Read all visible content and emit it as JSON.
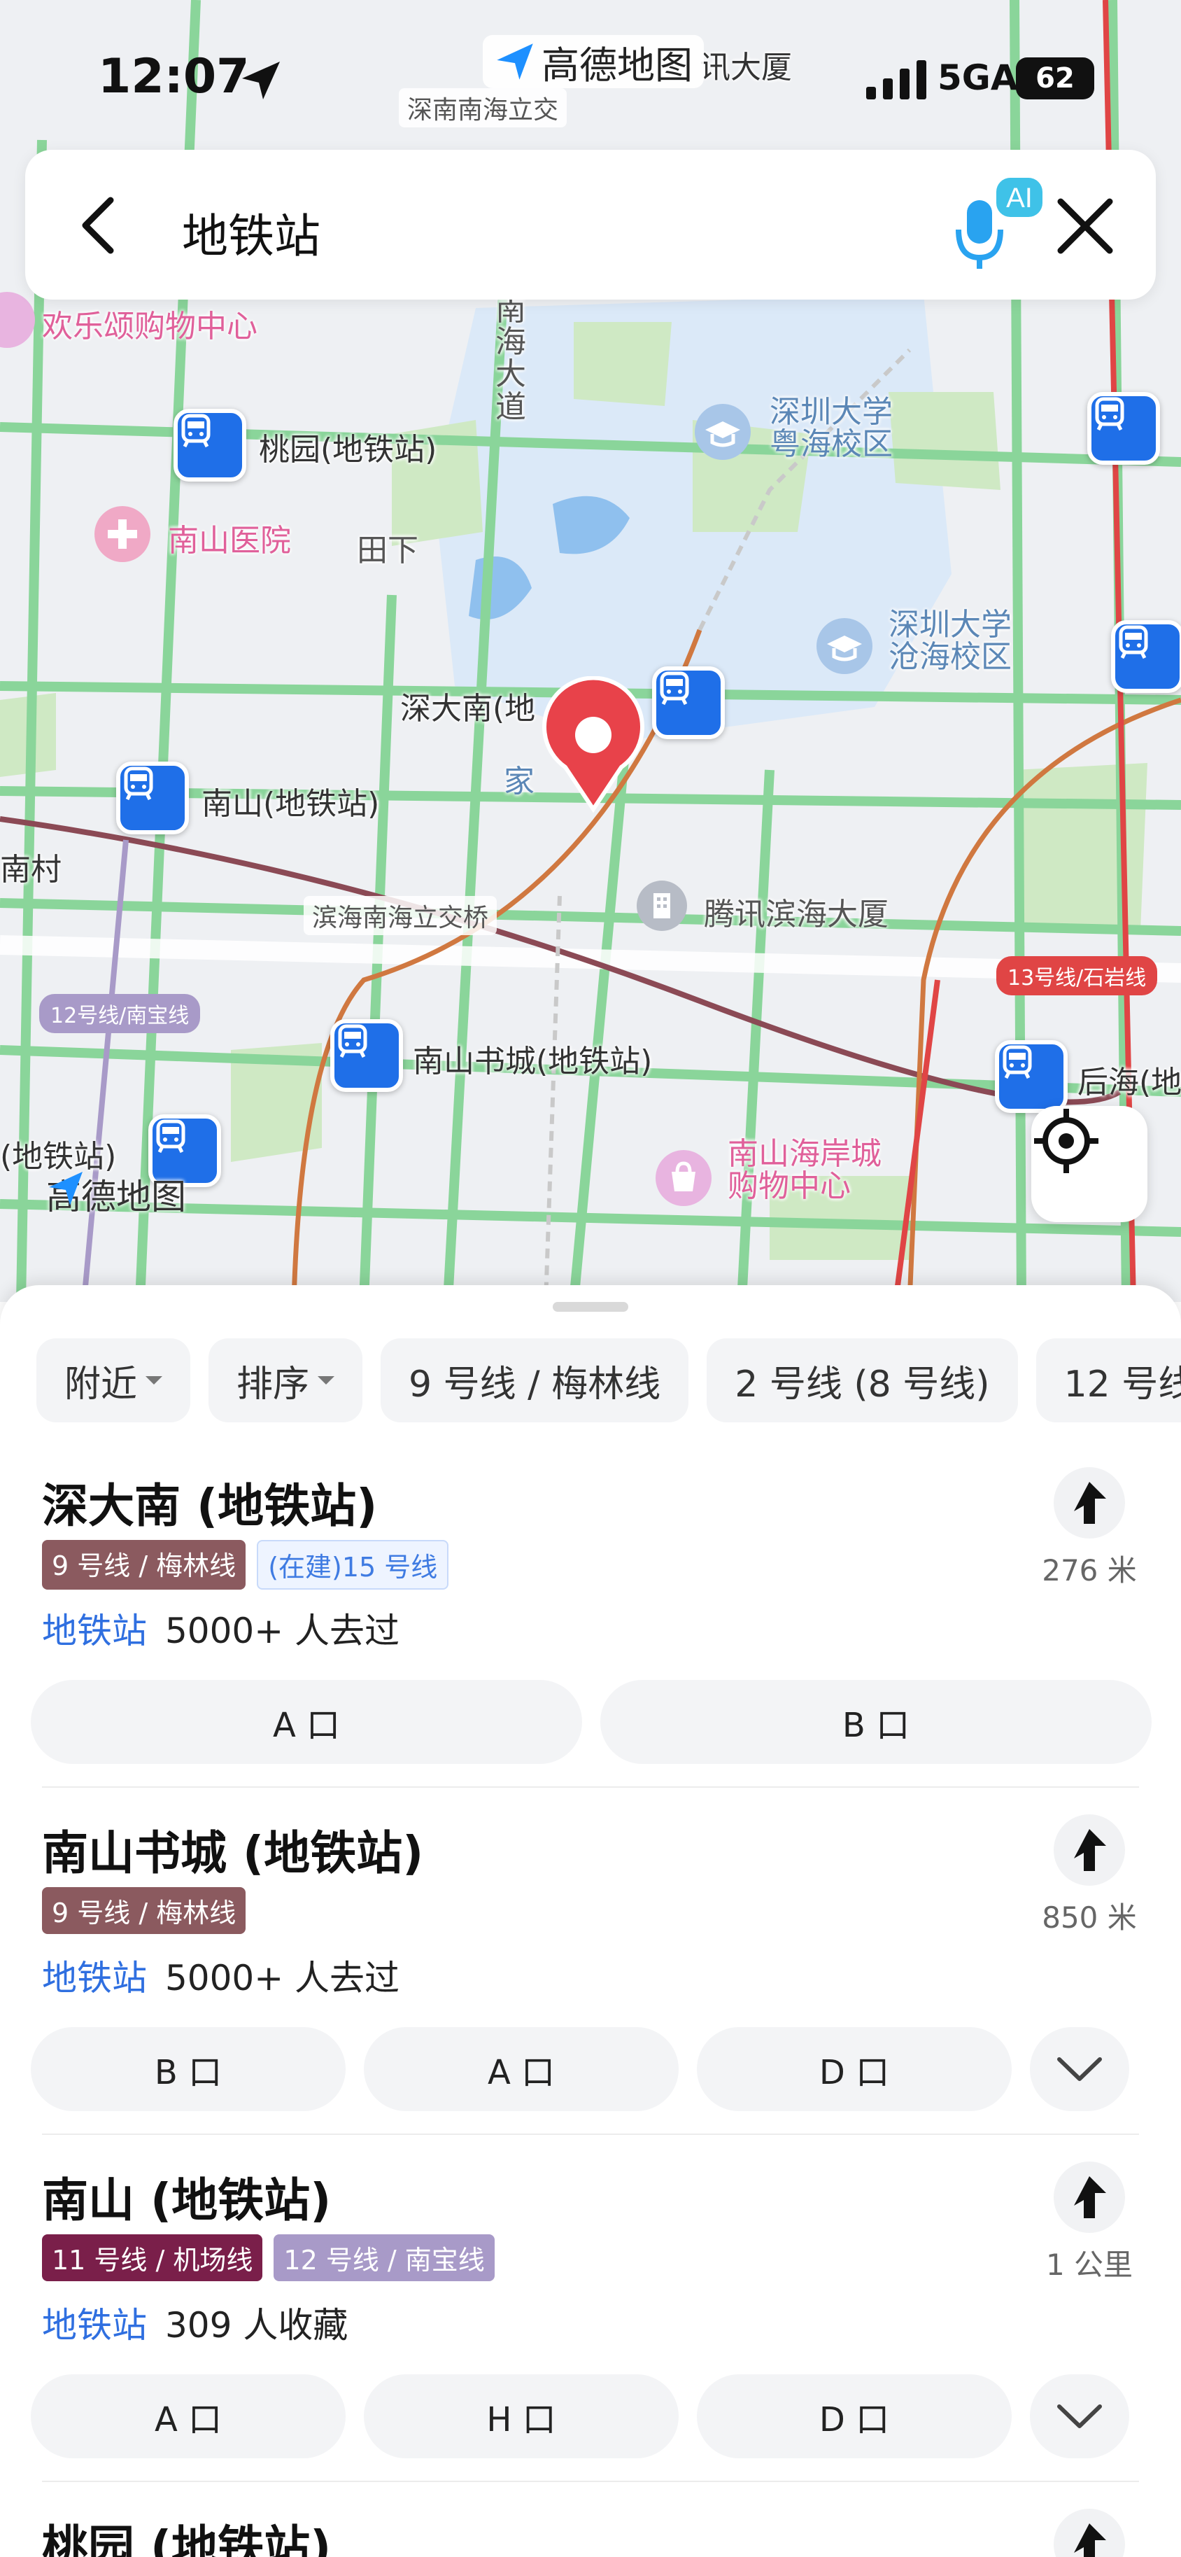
{
  "status": {
    "time": "12:07",
    "network": "5GA",
    "battery": "62"
  },
  "map": {
    "brand_top": "高德地图",
    "brand_bottom": "高德地图",
    "labels": {
      "xunxun": "讯大厦",
      "shennan_nanhai": "深南南海立交",
      "shen_partial": "深大",
      "huanle": "欢乐颂购物中心",
      "nanhai_dadao": "南海大道",
      "taoyuan": "桃园(地铁站)",
      "szu_yuehai": "深圳大学\n粤海校区",
      "nanshan_hospital": "南山医院",
      "tianxia": "田下",
      "szu_canghai": "深圳大学\n沧海校区",
      "shendanan_partial": "深大南(地",
      "jia": "家",
      "nanshan": "南山(地铁站)",
      "nancun": "南村",
      "binhai_lijiao": "滨海南海立交桥",
      "tencent": "腾讯滨海大厦",
      "line13": "13号线/石岩线",
      "line12": "12号线/南宝线",
      "nanshan_bookcity": "南山书城(地铁站)",
      "houhai": "后海(地",
      "ditiezhan_left": "(地铁站)",
      "nanhai_coast": "南山海岸城\n购物中心"
    }
  },
  "search": {
    "query": "地铁站",
    "ai_badge": "AI"
  },
  "filters": [
    {
      "label": "附近",
      "dropdown": true
    },
    {
      "label": "排序",
      "dropdown": true
    },
    {
      "label": "9 号线 / 梅林线",
      "dropdown": false
    },
    {
      "label": "2 号线 (8 号线)",
      "dropdown": false
    },
    {
      "label": "12 号线",
      "dropdown": false
    }
  ],
  "results": [
    {
      "title": "深大南 (地铁站)",
      "tags": [
        {
          "text": "9 号线 / 梅林线",
          "color": "#8b5a5f"
        },
        {
          "text": "(在建)15 号线",
          "color": "outline"
        }
      ],
      "category": "地铁站",
      "info": "5000+ 人去过",
      "distance": "276 米",
      "exits": [
        "A 口",
        "B 口"
      ],
      "has_expand": false
    },
    {
      "title": "南山书城 (地铁站)",
      "tags": [
        {
          "text": "9 号线 / 梅林线",
          "color": "#8b5a5f"
        }
      ],
      "category": "地铁站",
      "info": "5000+ 人去过",
      "distance": "850 米",
      "exits": [
        "B 口",
        "A 口",
        "D 口"
      ],
      "has_expand": true
    },
    {
      "title": "南山 (地铁站)",
      "tags": [
        {
          "text": "11 号线 / 机场线",
          "color": "#7a1f4a"
        },
        {
          "text": "12 号线 / 南宝线",
          "color": "#a89ac8"
        }
      ],
      "category": "地铁站",
      "info": "309 人收藏",
      "distance": "1 公里",
      "exits": [
        "A 口",
        "H 口",
        "D 口"
      ],
      "has_expand": true
    },
    {
      "title": "桃园 (地铁站)",
      "tags": [],
      "category": "",
      "info": "",
      "distance": "",
      "exits": [],
      "has_expand": false
    }
  ],
  "colors": {
    "accent": "#2f6fe0",
    "metro_pin": "#1f6fe8",
    "marker": "#e8424a",
    "line13": "#e04545",
    "line12": "#a89ac8"
  }
}
